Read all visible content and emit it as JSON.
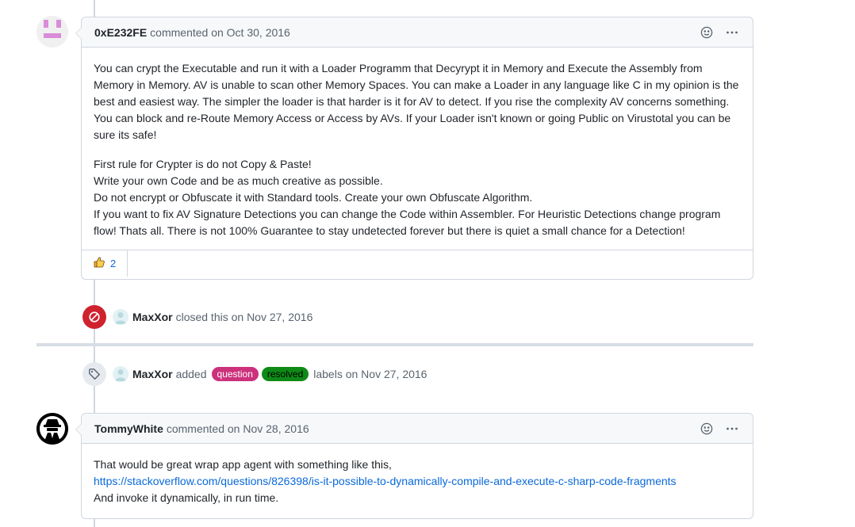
{
  "comments": [
    {
      "author": "0xE232FE",
      "meta": "commented on Oct 30, 2016",
      "paragraphs": [
        "You can crypt the Executable and run it with a Loader Programm that Decyrypt it in Memory and Execute the Assembly from Memory in Memory. AV is unable to scan other Memory Spaces. You can make a Loader in any language like C in my opinion is the best and easiest way. The simpler the loader is that harder is it for AV to detect. If you rise the complexity AV concerns something. You can block and re-Route Memory Access or Access by AVs. If your Loader isn't known or going Public on Virustotal you can be sure its safe!"
      ],
      "lines": [
        "First rule for Crypter is do not Copy & Paste!",
        "Write your own Code and be as much creative as possible.",
        "Do not encrypt or Obfuscate it with Standard tools. Create your own Obfuscate Algorithm.",
        "If you want to fix AV Signature Detections you can change the Code within Assembler. For Heuristic Detections change program flow! Thats all. There is not 100% Guarantee to stay undetected forever but there is quiet a small chance for a Detection!"
      ],
      "reaction": {
        "icon": "thumbs-up-icon",
        "count": "2"
      }
    },
    {
      "author": "TommyWhite",
      "meta": "commented on Nov 28, 2016",
      "line1": "That would be great wrap app agent with something like this,",
      "link": "https://stackoverflow.com/questions/826398/is-it-possible-to-dynamically-compile-and-execute-c-sharp-code-fragments",
      "line3": "And invoke it dynamically, in run time."
    }
  ],
  "events": {
    "closed": {
      "actor": "MaxXor",
      "text": "closed this on Nov 27, 2016",
      "icon": "closed-circle-icon",
      "color": "#cf222e"
    },
    "labeled": {
      "actor": "MaxXor",
      "added": "added",
      "labels": [
        {
          "name": "question",
          "bg": "#cc317c",
          "fg": "#ffffff"
        },
        {
          "name": "resolved",
          "bg": "#0e8a16",
          "fg": "#000000"
        }
      ],
      "suffix": "labels on Nov 27, 2016",
      "icon": "tag-icon"
    }
  }
}
